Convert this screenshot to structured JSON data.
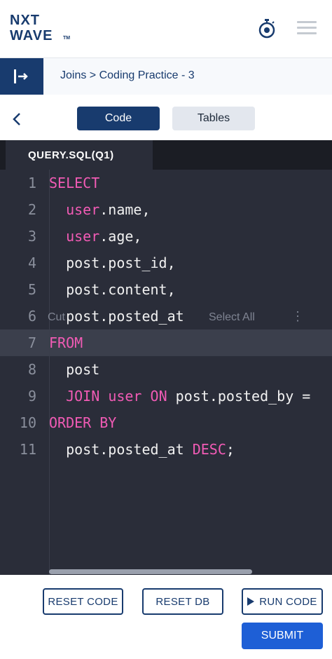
{
  "header": {
    "logo_line1": "NXT",
    "logo_line2": "WAVE",
    "logo_tm": "TM",
    "icons": [
      "stopwatch-icon",
      "hamburger-menu-icon"
    ]
  },
  "breadcrumb": {
    "text": "Joins > Coding Practice - 3",
    "toggle_icon": "sidebar-expand-icon"
  },
  "tabs": [
    {
      "label": "Code",
      "active": true
    },
    {
      "label": "Tables",
      "active": false
    }
  ],
  "editor": {
    "file_tab": "QUERY.SQL(Q1)",
    "active_line": 7,
    "lines": [
      {
        "num": "1",
        "parts": [
          {
            "t": "SELECT",
            "kw": true
          }
        ]
      },
      {
        "num": "2",
        "parts": [
          {
            "t": "  "
          },
          {
            "t": "user",
            "kw": true
          },
          {
            "t": ".name,"
          }
        ]
      },
      {
        "num": "3",
        "parts": [
          {
            "t": "  "
          },
          {
            "t": "user",
            "kw": true
          },
          {
            "t": ".age,"
          }
        ]
      },
      {
        "num": "4",
        "parts": [
          {
            "t": "  post.post_id,"
          }
        ]
      },
      {
        "num": "5",
        "parts": [
          {
            "t": "  post.content,"
          }
        ]
      },
      {
        "num": "6",
        "parts": [
          {
            "t": "  post.posted_at"
          }
        ]
      },
      {
        "num": "7",
        "parts": [
          {
            "t": "FROM",
            "kw": true
          }
        ]
      },
      {
        "num": "8",
        "parts": [
          {
            "t": "  post"
          }
        ]
      },
      {
        "num": "9",
        "parts": [
          {
            "t": "  "
          },
          {
            "t": "JOIN",
            "kw": true
          },
          {
            "t": " "
          },
          {
            "t": "user",
            "kw": true
          },
          {
            "t": " "
          },
          {
            "t": "ON",
            "kw": true
          },
          {
            "t": " post.posted_by ="
          }
        ]
      },
      {
        "num": "10",
        "parts": [
          {
            "t": "ORDER BY",
            "kw": true
          }
        ]
      },
      {
        "num": "11",
        "parts": [
          {
            "t": "  post.posted_at "
          },
          {
            "t": "DESC",
            "kw": true
          },
          {
            "t": ";"
          }
        ]
      }
    ],
    "context_menu": {
      "cut": "Cut",
      "select_all": "Select All",
      "more": "⋮"
    }
  },
  "actions": {
    "reset_code": "RESET CODE",
    "reset_db": "RESET DB",
    "run_code": "RUN CODE",
    "submit": "SUBMIT"
  },
  "colors": {
    "brand": "#183b6e",
    "keyword": "#f15bb5",
    "editor_bg": "#2a2d39",
    "submit": "#1e5fd6"
  }
}
